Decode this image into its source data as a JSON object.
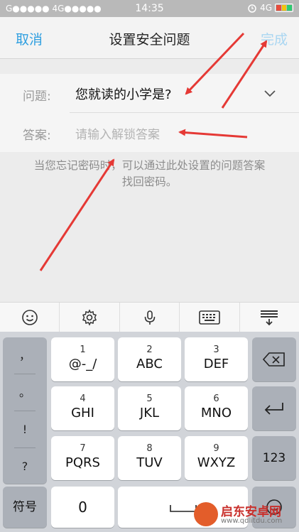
{
  "status_bar": {
    "left_text": "G●●●●● 4G●●●●●",
    "time": "14:35",
    "network": "4G",
    "battery_colors": [
      "#e74c3c",
      "#f1c40f",
      "#2ecc71"
    ]
  },
  "nav": {
    "cancel_label": "取消",
    "title": "设置安全问题",
    "done_label": "完成",
    "accent_color": "#2f9fe0"
  },
  "form": {
    "question_label": "问题:",
    "question_value": "您就读的小学是?",
    "answer_label": "答案:",
    "answer_placeholder": "请输入解锁答案",
    "answer_value": ""
  },
  "hint": {
    "line1": "当您忘记密码时，可以通过此处设置的问题答案",
    "line2": "找回密码。"
  },
  "toolbar": {
    "icons": [
      "emoji-icon",
      "settings-icon",
      "microphone-icon",
      "keyboard-icon",
      "hide-keyboard-icon"
    ]
  },
  "keyboard": {
    "punctuation": [
      "，",
      "。",
      "!",
      "?"
    ],
    "keys": [
      {
        "num": "1",
        "letters": "@-_/"
      },
      {
        "num": "2",
        "letters": "ABC"
      },
      {
        "num": "3",
        "letters": "DEF"
      },
      {
        "num": "4",
        "letters": "GHI"
      },
      {
        "num": "5",
        "letters": "JKL"
      },
      {
        "num": "6",
        "letters": "MNO"
      },
      {
        "num": "7",
        "letters": "PQRS"
      },
      {
        "num": "8",
        "letters": "TUV"
      },
      {
        "num": "9",
        "letters": "WXYZ"
      }
    ],
    "backspace_icon": "backspace-icon",
    "enter_icon": "return-icon",
    "num_switch_label": "123",
    "symbol_label": "符号",
    "zero_label": "0",
    "space_icon": "space-icon"
  },
  "watermark": {
    "name": "启东安卓网",
    "url": "www.qdlitdu.com"
  }
}
